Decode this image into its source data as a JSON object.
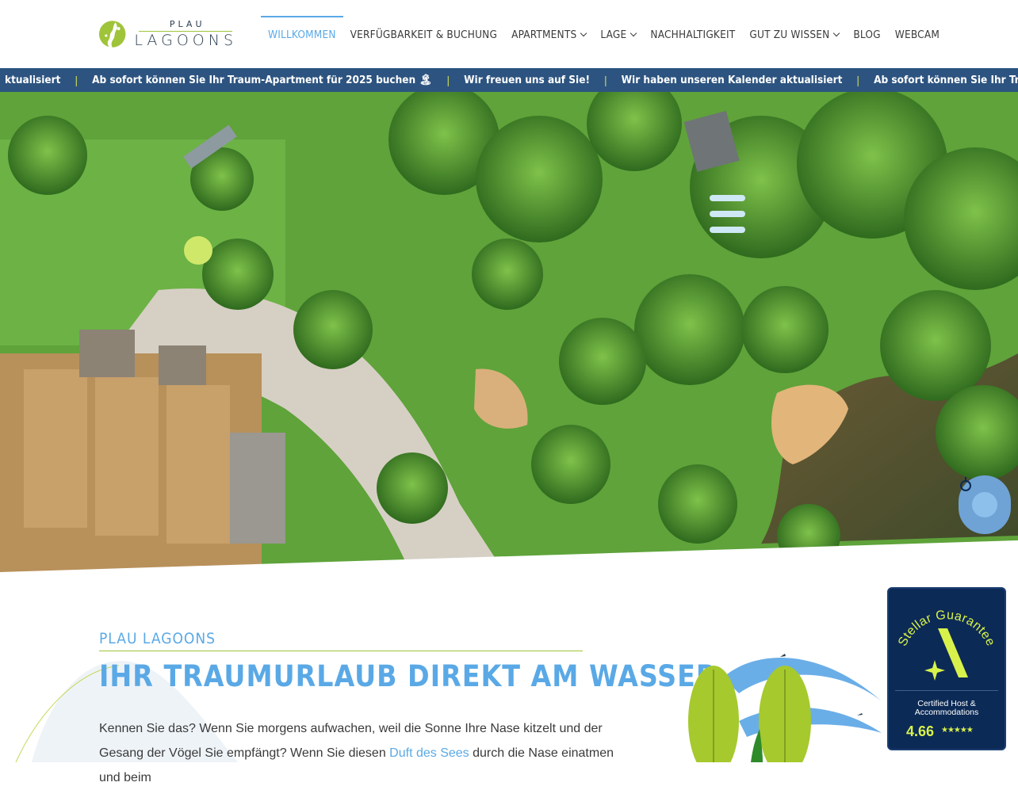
{
  "brand": {
    "top": "PLAU",
    "bottom": "LAGOONS",
    "accent": "#9fc43a",
    "text_color": "#2c3e50"
  },
  "nav": {
    "items": [
      {
        "label": "WILLKOMMEN",
        "active": true,
        "dropdown": false
      },
      {
        "label": "VERFÜGBARKEIT & BUCHUNG",
        "active": false,
        "dropdown": false
      },
      {
        "label": "APARTMENTS",
        "active": false,
        "dropdown": true
      },
      {
        "label": "LAGE",
        "active": false,
        "dropdown": true
      },
      {
        "label": "NACHHALTIGKEIT",
        "active": false,
        "dropdown": false
      },
      {
        "label": "GUT ZU WISSEN",
        "active": false,
        "dropdown": true
      },
      {
        "label": "BLOG",
        "active": false,
        "dropdown": false
      },
      {
        "label": "WEBCAM",
        "active": false,
        "dropdown": false
      }
    ],
    "active_color": "#5aa9e6"
  },
  "ticker": {
    "separator": "|",
    "messages": [
      "ktualisiert",
      "Ab sofort können Sie Ihr Traum-Apartment für 2025 buchen 🏝",
      "Wir freuen uns auf Sie!",
      "Wir haben unseren Kalender aktualisiert",
      "Ab sofort können Sie Ihr Traum-"
    ],
    "background": "#2d5480"
  },
  "hero": {
    "alt_icon": "aerial-photo-icon"
  },
  "help_button": {
    "icon": "help-icon"
  },
  "intro": {
    "eyebrow": "PLAU LAGOONS",
    "headline": "Ihr Traumurlaub direkt am Wasser",
    "body_before": "Kennen Sie das? Wenn Sie morgens aufwachen, weil die Sonne Ihre Nase kitzelt und der Gesang der Vögel Sie empfängt? Wenn Sie diesen ",
    "body_link": "Duft des Sees",
    "body_after": " durch die Nase einatmen und beim"
  },
  "badge": {
    "title": "Stellar Guarantee",
    "cert_line1": "Certified Host &",
    "cert_line2": "Accommodations",
    "score": "4.66",
    "stars": "★★★★★",
    "background": "#0c2a56",
    "accent": "#d8f24b"
  }
}
